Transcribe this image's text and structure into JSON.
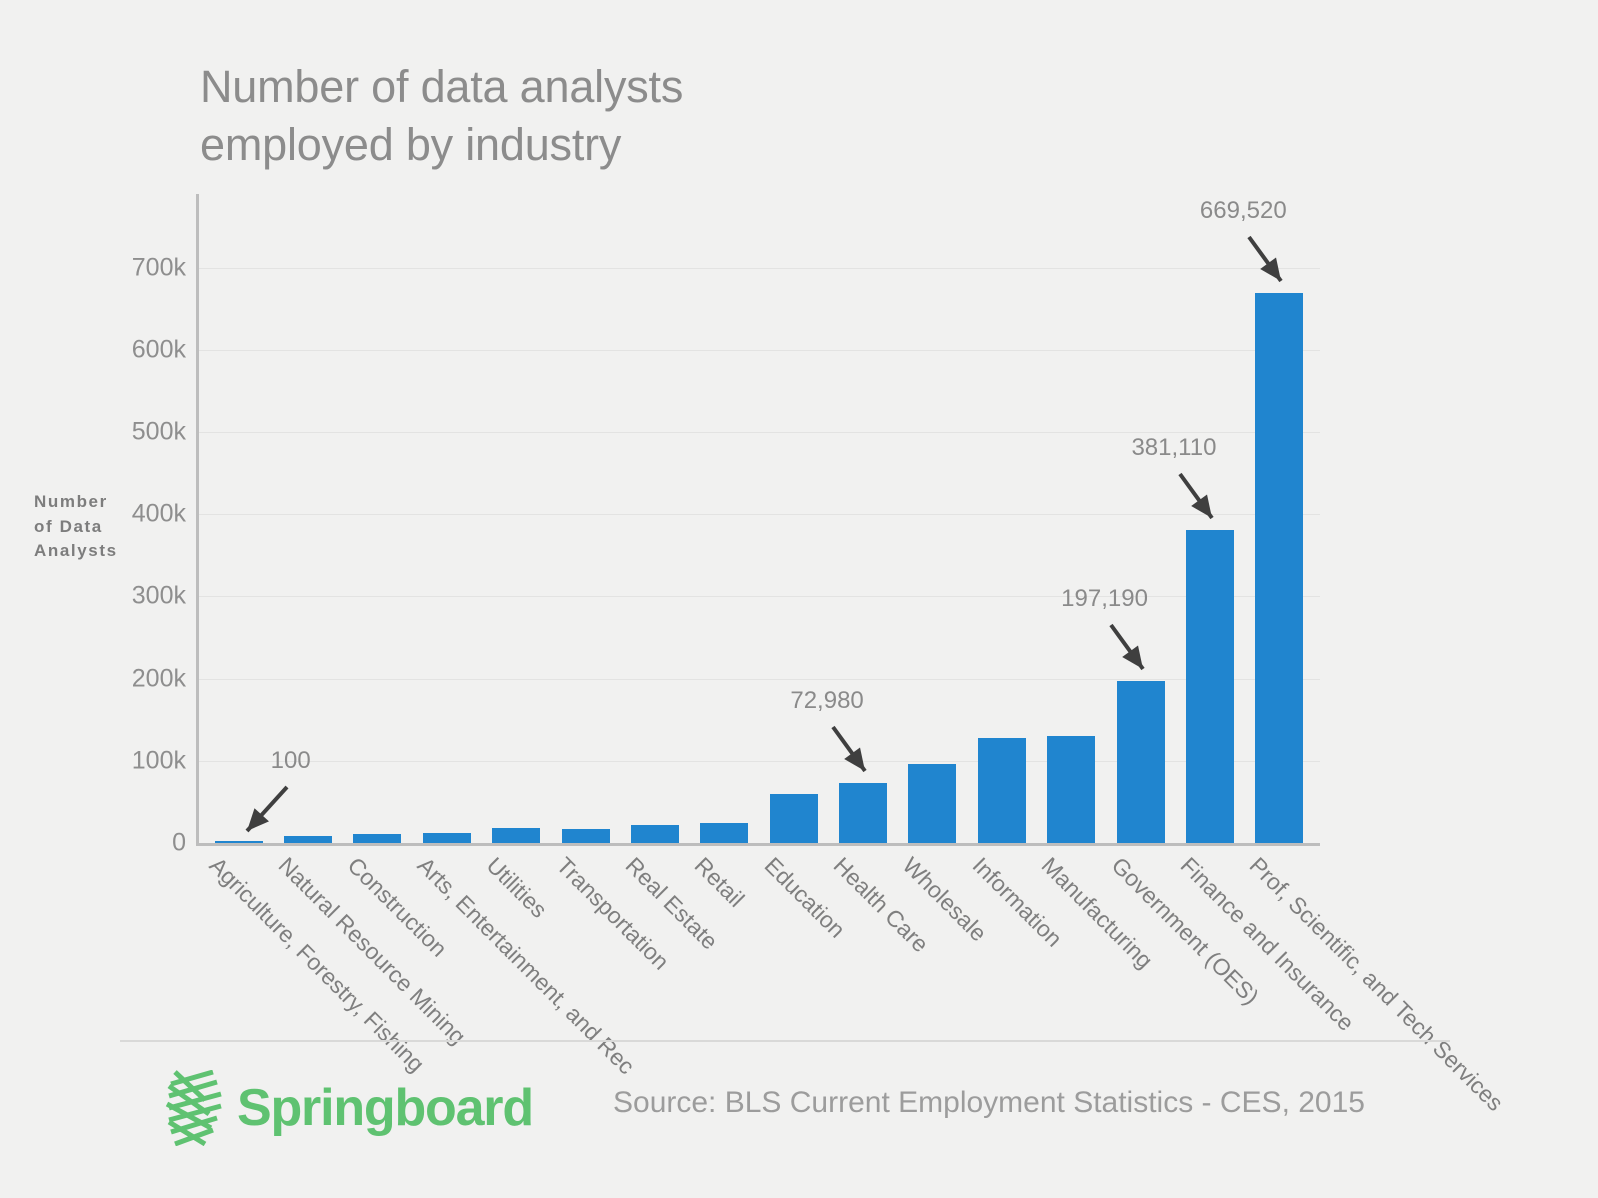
{
  "chart_data": {
    "type": "bar",
    "title": "Number of data analysts\nemployed by industry",
    "xlabel": "",
    "ylabel": "Number\nof  Data\nAnalysts",
    "ylim": [
      0,
      780000
    ],
    "grid": true,
    "legend": "none",
    "bar_color": "#2085cf",
    "categories": [
      "Agriculture, Forestry, Fishing",
      "Natural Resource Mining",
      "Construction",
      "Arts, Entertainment, and Rec",
      "Utilities",
      "Transportation",
      "Real Estate",
      "Retail",
      "Education",
      "Health Care",
      "Wholesale",
      "Information",
      "Manufacturing",
      "Government (OES)",
      "Finance and Insurance",
      "Prof, Scientific, and Tech Services"
    ],
    "values": [
      100,
      8600,
      10800,
      12400,
      17800,
      17600,
      22400,
      24600,
      59800,
      72980,
      96200,
      128000,
      130000,
      197190,
      381110,
      669520
    ],
    "ytick_labels": [
      "0",
      "100k",
      "200k",
      "300k",
      "400k",
      "500k",
      "600k",
      "700k"
    ],
    "ytick_values": [
      0,
      100000,
      200000,
      300000,
      400000,
      500000,
      600000,
      700000
    ],
    "annotations": [
      {
        "label": "100",
        "category_index": 0,
        "arrow_direction": "down-left"
      },
      {
        "label": "72,980",
        "category_index": 9,
        "arrow_direction": "down-right"
      },
      {
        "label": "197,190",
        "category_index": 13,
        "arrow_direction": "down-right"
      },
      {
        "label": "381,110",
        "category_index": 14,
        "arrow_direction": "down-right"
      },
      {
        "label": "669,520",
        "category_index": 15,
        "arrow_direction": "down-right"
      }
    ]
  },
  "footer": {
    "brand_name": "Springboard",
    "brand_color": "#5fc271",
    "source": "Source: BLS Current Employment Statistics - CES, 2015"
  }
}
